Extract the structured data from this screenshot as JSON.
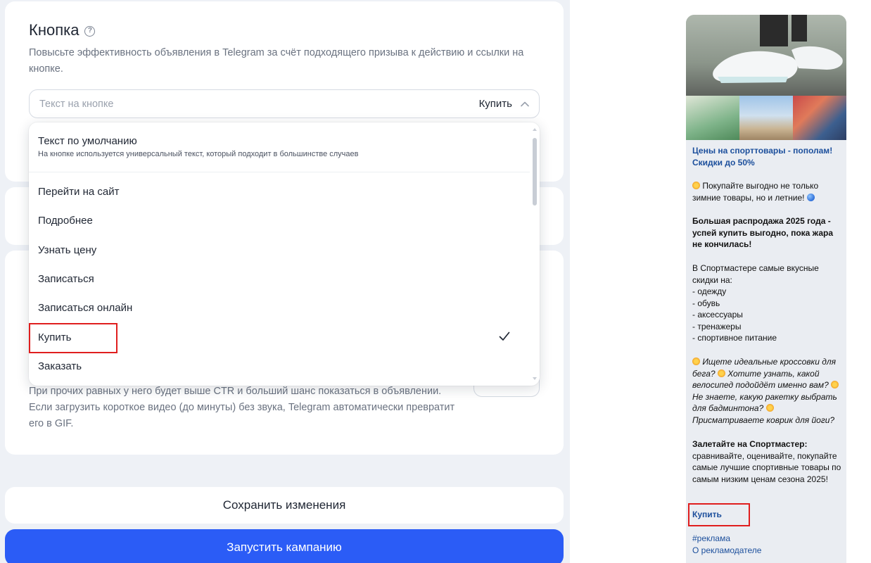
{
  "button_section": {
    "title": "Кнопка",
    "help_icon": "question-circle-icon",
    "description": "Повысьте эффективность объявления в Telegram за счёт подходящего призыва к действию и ссылки на кнопке.",
    "select": {
      "placeholder": "Текст на кнопке",
      "value": "Купить",
      "expanded": true
    },
    "dropdown": {
      "default_option": {
        "title": "Текст по умолчанию",
        "subtitle": "На кнопке используется универсальный текст, который подходит в большинстве случаев"
      },
      "options": [
        {
          "label": "Перейти на сайт",
          "selected": false
        },
        {
          "label": "Подробнее",
          "selected": false
        },
        {
          "label": "Узнать цену",
          "selected": false
        },
        {
          "label": "Записаться",
          "selected": false
        },
        {
          "label": "Записаться онлайн",
          "selected": false
        },
        {
          "label": "Купить",
          "selected": true
        },
        {
          "label": "Заказать",
          "selected": false
        }
      ]
    }
  },
  "media_section": {
    "text": "При прочих равных у него будет выше CTR и больший шанс показаться в объявлении. Если загрузить короткое видео (до минуты) без звука, Telegram автоматически превратит его в GIF."
  },
  "actions": {
    "save_label": "Сохранить изменения",
    "launch_label": "Запустить кампанию"
  },
  "preview": {
    "title": "Цены на спорттовары - пополам! Скидки до 50%",
    "intro": "Покупайте выгодно не только зимние товары, но и летние!",
    "headline": "Большая распродажа 2025 года - успей купить выгодно, пока жара не кончилась!",
    "list_intro": "В Спортмастере самые вкусные скидки на:",
    "list_items": [
      "- одежду",
      "- обувь",
      "- аксессуары",
      "- тренажеры",
      "- спортивное питание"
    ],
    "questions": [
      "Ищете идеальные кроссовки для бега?",
      "Хотите узнать, какой велосипед подойдёт именно вам?",
      "Не знаете, какую ракетку выбрать для бадминтона?",
      "Присматриваете коврик для йоги?"
    ],
    "cta_bold": "Залетайте на Спортмастер:",
    "cta_text": "сравнивайте, оценивайте, покупайте самые лучшие спортивные товары по самым низким ценам сезона 2025!",
    "button_label": "Купить",
    "hashtag": "#реклама",
    "advertiser_link": "О рекламодателе",
    "emoji_sparkle": "sparkles-icon",
    "emoji_globe": "globe-icon"
  },
  "colors": {
    "accent": "#2b5cf6",
    "highlight": "#e01e1e",
    "link": "#1c4f9c",
    "page_bg": "#eef1f6"
  }
}
